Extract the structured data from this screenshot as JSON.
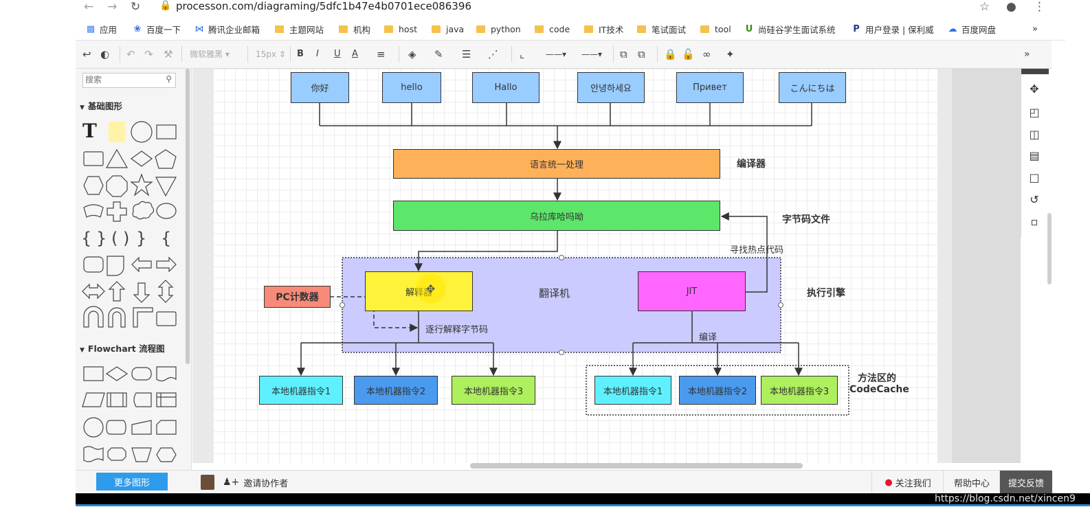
{
  "browser": {
    "url": "processon.com/diagraming/5dfc1b47e4b0701ece086396",
    "bookmarks": [
      "应用",
      "百度一下",
      "腾讯企业邮箱",
      "主题网站",
      "机构",
      "host",
      "java",
      "python",
      "code",
      "IT技术",
      "笔试面试",
      "tool",
      "尚硅谷学生面试系统",
      "用户登录 | 保利威",
      "百度网盘"
    ],
    "overflow": "»"
  },
  "toolbar": {
    "font_family": "微软雅黑",
    "font_size": "15px",
    "bold": "B",
    "italic": "I",
    "underline": "U",
    "font_color": "A",
    "collapse": "»"
  },
  "left_panel": {
    "search_placeholder": "搜索",
    "section_basic": "基础图形",
    "section_flowchart": "Flowchart 流程图",
    "more_shapes": "更多图形"
  },
  "diagram": {
    "languages": [
      "你好",
      "hello",
      "Hallo",
      "안녕하세요",
      "Привет",
      "こんにちは"
    ],
    "compiler_box": "语言统一处理",
    "compiler_label": "编译器",
    "bytecode_box": "乌拉库哈吗呦",
    "bytecode_label": "字节码文件",
    "hotspot_label": "寻找热点代码",
    "pc_counter": "PC计数器",
    "interpreter": "解释器",
    "translator": "翻译机",
    "jit": "JIT",
    "engine_label": "执行引擎",
    "interpret_label": "逐行解释字节码",
    "compile_label": "编译",
    "native_left": [
      "本地机器指令1",
      "本地机器指令2",
      "本地机器指令3"
    ],
    "native_right": [
      "本地机器指令1",
      "本地机器指令2",
      "本地机器指令3"
    ],
    "codecache_line1": "方法区的",
    "codecache_line2": "CodeCache",
    "colors": {
      "lang": "#99ccff",
      "compiler": "#ffb15a",
      "bytecode": "#5ce66a",
      "engine_bg": "#cbcbff",
      "interpreter": "#fff23a",
      "jit": "#ff66ff",
      "pc": "#f88a7a",
      "native_cyan": "#5ff0ff",
      "native_blue": "#4a9bef",
      "native_green": "#adef5c"
    }
  },
  "bottom": {
    "invite": "邀请协作者",
    "follow": "关注我们",
    "help": "帮助中心",
    "feedback": "提交反馈"
  },
  "watermark": "https://blog.csdn.net/xincen9"
}
